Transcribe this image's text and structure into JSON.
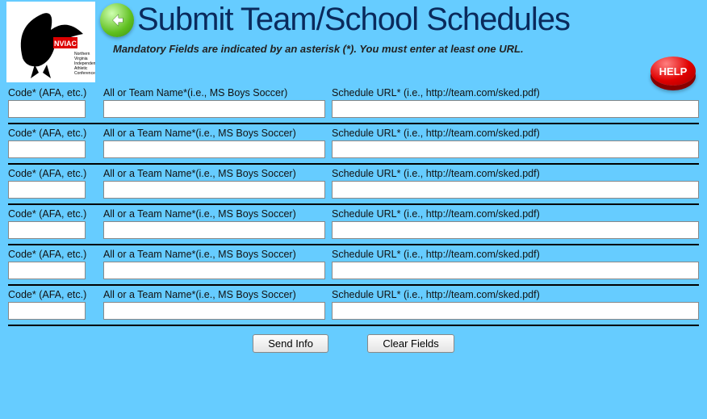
{
  "logo": {
    "banner1": "NVIAC",
    "banner2_lines": [
      "Northern",
      "Virginia",
      "Independent",
      "Athletic",
      "Conference"
    ]
  },
  "header": {
    "title": "Submit Team/School Schedules",
    "subtitle": "Mandatory Fields are indicated by an asterisk (*). You must enter at least one URL.",
    "help_label": "HELP"
  },
  "labels": {
    "code": "Code* (AFA, etc.)",
    "team_first": "All or Team Name*(i.e., MS Boys Soccer)",
    "team_rest": "All or a Team Name*(i.e., MS Boys Soccer)",
    "url": "Schedule URL* (i.e., http://team.com/sked.pdf)"
  },
  "rows": [
    {
      "code": "",
      "team": "",
      "url": ""
    },
    {
      "code": "",
      "team": "",
      "url": ""
    },
    {
      "code": "",
      "team": "",
      "url": ""
    },
    {
      "code": "",
      "team": "",
      "url": ""
    },
    {
      "code": "",
      "team": "",
      "url": ""
    },
    {
      "code": "",
      "team": "",
      "url": ""
    }
  ],
  "buttons": {
    "send": "Send Info",
    "clear": "Clear Fields"
  }
}
